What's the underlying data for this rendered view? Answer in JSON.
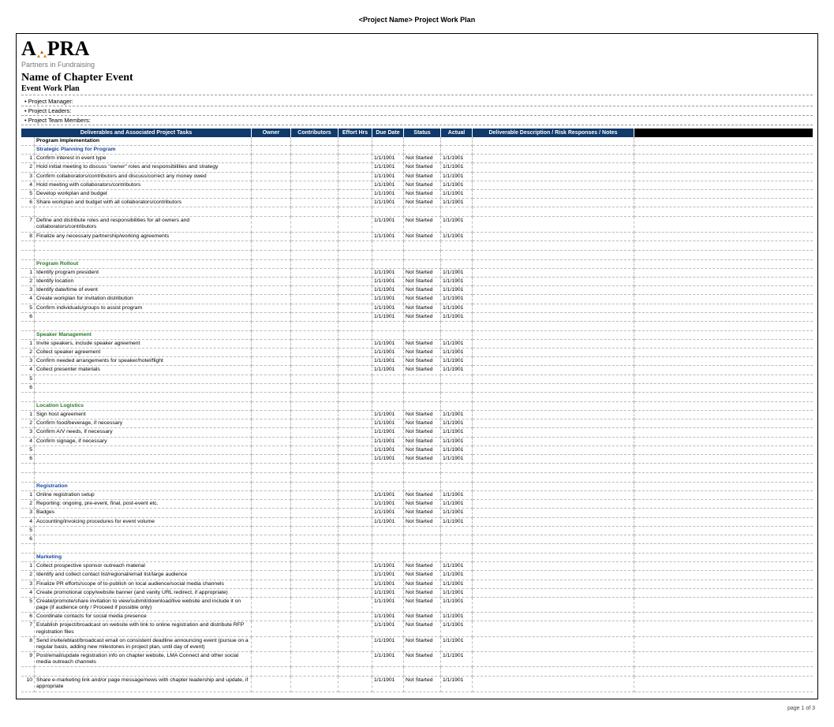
{
  "doc_header": "<Project Name>  Project Work Plan",
  "logo_tag": "Partners in Fundraising",
  "title_main": "Name of Chapter Event",
  "title_sub": "Event Work Plan",
  "info_rows": [
    "Project Manager:",
    "Project Leaders:",
    "Project Team Members:"
  ],
  "columns": [
    "",
    "Deliverables and Associated Project Tasks",
    "Owner",
    "Contributors",
    "Effort Hrs",
    "Due Date",
    "Status",
    "Actual",
    "Deliverable Description / Risk Responses / Notes",
    ""
  ],
  "sections": [
    {
      "type": "header",
      "label": "Program Implementation"
    },
    {
      "type": "subheader",
      "color": "blue",
      "label": "Strategic Planning for Program"
    },
    {
      "type": "task",
      "num": "1",
      "label": "Confirm interest in event type",
      "due": "1/1/1901",
      "status": "Not Started",
      "actual": "1/1/1901"
    },
    {
      "type": "task",
      "num": "2",
      "label": "Hold initial meeting to discuss \"owner\" roles and responsibilities and strategy",
      "due": "1/1/1901",
      "status": "Not Started",
      "actual": "1/1/1901"
    },
    {
      "type": "task",
      "num": "3",
      "label": "Confirm collaborators/contributors and discuss/correct any money owed",
      "due": "1/1/1901",
      "status": "Not Started",
      "actual": "1/1/1901"
    },
    {
      "type": "task",
      "num": "4",
      "label": "Hold meeting with collaborators/contributors",
      "due": "1/1/1901",
      "status": "Not Started",
      "actual": "1/1/1901"
    },
    {
      "type": "task",
      "num": "5",
      "label": "Develop workplan and budget",
      "due": "1/1/1901",
      "status": "Not Started",
      "actual": "1/1/1901"
    },
    {
      "type": "task",
      "num": "6",
      "label": "Share workplan and budget with all collaborators/contributors",
      "due": "1/1/1901",
      "status": "Not Started",
      "actual": "1/1/1901"
    },
    {
      "type": "blank"
    },
    {
      "type": "task",
      "num": "7",
      "label": "Define and distribute roles and responsibilities for all owners and collaborators/contributors",
      "due": "1/1/1901",
      "status": "Not Started",
      "actual": "1/1/1901"
    },
    {
      "type": "task",
      "num": "8",
      "label": "Finalize any necessary partnership/working agreements",
      "due": "1/1/1901",
      "status": "Not Started",
      "actual": "1/1/1901"
    },
    {
      "type": "blank"
    },
    {
      "type": "blank"
    },
    {
      "type": "subheader",
      "color": "green",
      "label": "Program Rollout"
    },
    {
      "type": "task",
      "num": "1",
      "label": "Identify program president",
      "due": "1/1/1901",
      "status": "Not Started",
      "actual": "1/1/1901"
    },
    {
      "type": "task",
      "num": "2",
      "label": "Identify location",
      "due": "1/1/1901",
      "status": "Not Started",
      "actual": "1/1/1901"
    },
    {
      "type": "task",
      "num": "3",
      "label": "Identify date/time of event",
      "due": "1/1/1901",
      "status": "Not Started",
      "actual": "1/1/1901"
    },
    {
      "type": "task",
      "num": "4",
      "label": "Create workplan for invitation distribution",
      "due": "1/1/1901",
      "status": "Not Started",
      "actual": "1/1/1901"
    },
    {
      "type": "task",
      "num": "5",
      "label": "Confirm individuals/groups to assist program",
      "due": "1/1/1901",
      "status": "Not Started",
      "actual": "1/1/1901"
    },
    {
      "type": "task",
      "num": "6",
      "label": "",
      "due": "1/1/1901",
      "status": "Not Started",
      "actual": "1/1/1901"
    },
    {
      "type": "blank"
    },
    {
      "type": "subheader",
      "color": "green",
      "label": "Speaker Management"
    },
    {
      "type": "task",
      "num": "1",
      "label": "Invite speakers, include speaker agreement",
      "due": "1/1/1901",
      "status": "Not Started",
      "actual": "1/1/1901"
    },
    {
      "type": "task",
      "num": "2",
      "label": "Collect speaker agreement",
      "due": "1/1/1901",
      "status": "Not Started",
      "actual": "1/1/1901"
    },
    {
      "type": "task",
      "num": "3",
      "label": "Confirm needed arrangements for speaker/hotel/flight",
      "due": "1/1/1901",
      "status": "Not Started",
      "actual": "1/1/1901"
    },
    {
      "type": "task",
      "num": "4",
      "label": "Collect presenter materials",
      "due": "1/1/1901",
      "status": "Not Started",
      "actual": "1/1/1901"
    },
    {
      "type": "task",
      "num": "5",
      "label": "",
      "due": "",
      "status": "",
      "actual": ""
    },
    {
      "type": "task",
      "num": "6",
      "label": "",
      "due": "",
      "status": "",
      "actual": ""
    },
    {
      "type": "blank"
    },
    {
      "type": "subheader",
      "color": "green",
      "label": "Location Logistics"
    },
    {
      "type": "task",
      "num": "1",
      "label": "Sign host agreement",
      "due": "1/1/1901",
      "status": "Not Started",
      "actual": "1/1/1901"
    },
    {
      "type": "task",
      "num": "2",
      "label": "Confirm food/beverage, if necessary",
      "due": "1/1/1901",
      "status": "Not Started",
      "actual": "1/1/1901"
    },
    {
      "type": "task",
      "num": "3",
      "label": "Confirm A/V needs, if necessary",
      "due": "1/1/1901",
      "status": "Not Started",
      "actual": "1/1/1901"
    },
    {
      "type": "task",
      "num": "4",
      "label": "Confirm signage, if necessary",
      "due": "1/1/1901",
      "status": "Not Started",
      "actual": "1/1/1901"
    },
    {
      "type": "task",
      "num": "5",
      "label": "",
      "due": "1/1/1901",
      "status": "Not Started",
      "actual": "1/1/1901"
    },
    {
      "type": "task",
      "num": "6",
      "label": "",
      "due": "1/1/1901",
      "status": "Not Started",
      "actual": "1/1/1901"
    },
    {
      "type": "blank"
    },
    {
      "type": "blank"
    },
    {
      "type": "subheader",
      "color": "blue",
      "label": "Registration"
    },
    {
      "type": "task",
      "num": "1",
      "label": "Online registration setup",
      "due": "1/1/1901",
      "status": "Not Started",
      "actual": "1/1/1901"
    },
    {
      "type": "task",
      "num": "2",
      "label": "Reporting: ongoing, pre-event, final, post-event etc.",
      "due": "1/1/1901",
      "status": "Not Started",
      "actual": "1/1/1901"
    },
    {
      "type": "task",
      "num": "3",
      "label": "Badges",
      "due": "1/1/1901",
      "status": "Not Started",
      "actual": "1/1/1901"
    },
    {
      "type": "task",
      "num": "4",
      "label": "Accounting/invoicing procedures for event volume",
      "due": "1/1/1901",
      "status": "Not Started",
      "actual": "1/1/1901"
    },
    {
      "type": "task",
      "num": "5",
      "label": "",
      "due": "",
      "status": "",
      "actual": ""
    },
    {
      "type": "task",
      "num": "6",
      "label": "",
      "due": "",
      "status": "",
      "actual": ""
    },
    {
      "type": "blank"
    },
    {
      "type": "subheader",
      "color": "blue",
      "label": "Marketing"
    },
    {
      "type": "task",
      "num": "1",
      "label": "Collect prospective sponsor outreach material",
      "due": "1/1/1901",
      "status": "Not Started",
      "actual": "1/1/1901"
    },
    {
      "type": "task",
      "num": "2",
      "label": "Identify and collect contact list/regional/email list/large audience",
      "due": "1/1/1901",
      "status": "Not Started",
      "actual": "1/1/1901"
    },
    {
      "type": "task",
      "num": "3",
      "label": "Finalize PR efforts/scope of to-publish on local audience/social media channels",
      "due": "1/1/1901",
      "status": "Not Started",
      "actual": "1/1/1901"
    },
    {
      "type": "task",
      "num": "4",
      "label": "Create promotional copy/website banner (and vanity URL redirect, if appropriate)",
      "due": "1/1/1901",
      "status": "Not Started",
      "actual": "1/1/1901"
    },
    {
      "type": "task",
      "num": "5",
      "label": "Create/promote/share invitation to view/submit/download/live website and include it on page (if audience only / Proceed if possible only)",
      "due": "1/1/1901",
      "status": "Not Started",
      "actual": "1/1/1901"
    },
    {
      "type": "task",
      "num": "6",
      "label": "Coordinate contacts for social media presence",
      "due": "1/1/1901",
      "status": "Not Started",
      "actual": "1/1/1901"
    },
    {
      "type": "task",
      "num": "7",
      "label": "Establish project/broadcast on website with link to online registration and distribute RFP registration files",
      "due": "1/1/1901",
      "status": "Not Started",
      "actual": "1/1/1901"
    },
    {
      "type": "task",
      "num": "8",
      "label": "Send invite/eblast/broadcast email on consistent deadline announcing event (pursue on a regular basis, adding new milestones in project plan, until day of event)",
      "due": "1/1/1901",
      "status": "Not Started",
      "actual": "1/1/1901"
    },
    {
      "type": "task",
      "num": "9",
      "label": "Post/email/update registration info on chapter website, LMA Connect and other social media outreach channels",
      "due": "1/1/1901",
      "status": "Not Started",
      "actual": "1/1/1901"
    },
    {
      "type": "blank"
    },
    {
      "type": "task",
      "num": "10",
      "label": "Share e-marketing link and/or page message/news with chapter leadership and update, if appropriate",
      "due": "1/1/1901",
      "status": "Not Started",
      "actual": "1/1/1901"
    }
  ],
  "footer": "page 1 of 3"
}
